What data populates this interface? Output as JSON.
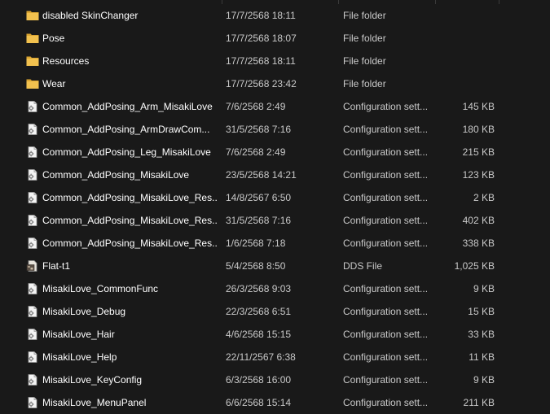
{
  "colors": {
    "background": "#191919",
    "text_primary": "#ffffff",
    "text_secondary": "#c9c9c9",
    "folder_icon": "#e8b23c"
  },
  "files": [
    {
      "name": "disabled SkinChanger",
      "date": "17/7/2568 18:11",
      "type": "File folder",
      "size": "",
      "icon": "folder-icon"
    },
    {
      "name": "Pose",
      "date": "17/7/2568 18:07",
      "type": "File folder",
      "size": "",
      "icon": "folder-icon"
    },
    {
      "name": "Resources",
      "date": "17/7/2568 18:11",
      "type": "File folder",
      "size": "",
      "icon": "folder-icon"
    },
    {
      "name": "Wear",
      "date": "17/7/2568 23:42",
      "type": "File folder",
      "size": "",
      "icon": "folder-icon"
    },
    {
      "name": "Common_AddPosing_Arm_MisakiLove",
      "date": "7/6/2568 2:49",
      "type": "Configuration sett...",
      "size": "145 KB",
      "icon": "config-file-icon"
    },
    {
      "name": "Common_AddPosing_ArmDrawCom...",
      "date": "31/5/2568 7:16",
      "type": "Configuration sett...",
      "size": "180 KB",
      "icon": "config-file-icon"
    },
    {
      "name": "Common_AddPosing_Leg_MisakiLove",
      "date": "7/6/2568 2:49",
      "type": "Configuration sett...",
      "size": "215 KB",
      "icon": "config-file-icon"
    },
    {
      "name": "Common_AddPosing_MisakiLove",
      "date": "23/5/2568 14:21",
      "type": "Configuration sett...",
      "size": "123 KB",
      "icon": "config-file-icon"
    },
    {
      "name": "Common_AddPosing_MisakiLove_Res...",
      "date": "14/8/2567 6:50",
      "type": "Configuration sett...",
      "size": "2 KB",
      "icon": "config-file-icon"
    },
    {
      "name": "Common_AddPosing_MisakiLove_Res...",
      "date": "31/5/2568 7:16",
      "type": "Configuration sett...",
      "size": "402 KB",
      "icon": "config-file-icon"
    },
    {
      "name": "Common_AddPosing_MisakiLove_Res...",
      "date": "1/6/2568 7:18",
      "type": "Configuration sett...",
      "size": "338 KB",
      "icon": "config-file-icon"
    },
    {
      "name": "Flat-t1",
      "date": "5/4/2568 8:50",
      "type": "DDS File",
      "size": "1,025 KB",
      "icon": "dds-image-icon"
    },
    {
      "name": "MisakiLove_CommonFunc",
      "date": "26/3/2568 9:03",
      "type": "Configuration sett...",
      "size": "9 KB",
      "icon": "config-file-icon"
    },
    {
      "name": "MisakiLove_Debug",
      "date": "22/3/2568 6:51",
      "type": "Configuration sett...",
      "size": "15 KB",
      "icon": "config-file-icon"
    },
    {
      "name": "MisakiLove_Hair",
      "date": "4/6/2568 15:15",
      "type": "Configuration sett...",
      "size": "33 KB",
      "icon": "config-file-icon"
    },
    {
      "name": "MisakiLove_Help",
      "date": "22/11/2567 6:38",
      "type": "Configuration sett...",
      "size": "11 KB",
      "icon": "config-file-icon"
    },
    {
      "name": "MisakiLove_KeyConfig",
      "date": "6/3/2568 16:00",
      "type": "Configuration sett...",
      "size": "9 KB",
      "icon": "config-file-icon"
    },
    {
      "name": "MisakiLove_MenuPanel",
      "date": "6/6/2568 15:14",
      "type": "Configuration sett...",
      "size": "211 KB",
      "icon": "config-file-icon"
    }
  ]
}
